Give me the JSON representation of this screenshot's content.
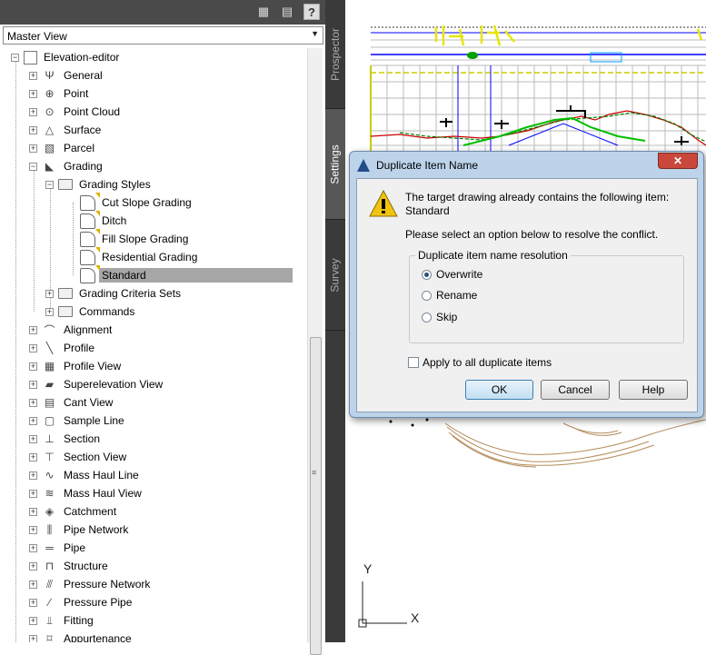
{
  "toolspace": {
    "toolbar_icons": [
      "tree-display-icon",
      "item-view-icon",
      "help-icon"
    ],
    "help_label": "?",
    "view_selector": "Master View",
    "tree": [
      {
        "label": "Elevation-editor",
        "indent": 0,
        "icon": "drawing-icon"
      },
      {
        "label": "General",
        "indent": 1,
        "icon": "general-icon"
      },
      {
        "label": "Point",
        "indent": 1,
        "icon": "point-icon"
      },
      {
        "label": "Point Cloud",
        "indent": 1,
        "icon": "point-cloud-icon"
      },
      {
        "label": "Surface",
        "indent": 1,
        "icon": "surface-icon"
      },
      {
        "label": "Parcel",
        "indent": 1,
        "icon": "parcel-icon"
      },
      {
        "label": "Grading",
        "indent": 1,
        "icon": "grading-icon"
      },
      {
        "label": "Grading Styles",
        "indent": 2,
        "icon": "folder-icon"
      },
      {
        "label": "Cut Slope Grading",
        "indent": 3,
        "icon": "style-icon"
      },
      {
        "label": "Ditch",
        "indent": 3,
        "icon": "style-icon"
      },
      {
        "label": "Fill Slope Grading",
        "indent": 3,
        "icon": "style-icon"
      },
      {
        "label": "Residential Grading",
        "indent": 3,
        "icon": "style-icon"
      },
      {
        "label": "Standard",
        "indent": 3,
        "icon": "style-icon",
        "selected": true
      },
      {
        "label": "Grading Criteria Sets",
        "indent": 2,
        "icon": "folder-icon"
      },
      {
        "label": "Commands",
        "indent": 2,
        "icon": "folder-icon"
      },
      {
        "label": "Alignment",
        "indent": 1,
        "icon": "alignment-icon"
      },
      {
        "label": "Profile",
        "indent": 1,
        "icon": "profile-icon"
      },
      {
        "label": "Profile View",
        "indent": 1,
        "icon": "profile-view-icon"
      },
      {
        "label": "Superelevation View",
        "indent": 1,
        "icon": "superelevation-view-icon"
      },
      {
        "label": "Cant View",
        "indent": 1,
        "icon": "cant-view-icon"
      },
      {
        "label": "Sample Line",
        "indent": 1,
        "icon": "sample-line-icon"
      },
      {
        "label": "Section",
        "indent": 1,
        "icon": "section-icon"
      },
      {
        "label": "Section View",
        "indent": 1,
        "icon": "section-view-icon"
      },
      {
        "label": "Mass Haul Line",
        "indent": 1,
        "icon": "mass-haul-line-icon"
      },
      {
        "label": "Mass Haul View",
        "indent": 1,
        "icon": "mass-haul-view-icon"
      },
      {
        "label": "Catchment",
        "indent": 1,
        "icon": "catchment-icon"
      },
      {
        "label": "Pipe Network",
        "indent": 1,
        "icon": "pipe-network-icon"
      },
      {
        "label": "Pipe",
        "indent": 1,
        "icon": "pipe-icon"
      },
      {
        "label": "Structure",
        "indent": 1,
        "icon": "structure-icon"
      },
      {
        "label": "Pressure Network",
        "indent": 1,
        "icon": "pressure-network-icon"
      },
      {
        "label": "Pressure Pipe",
        "indent": 1,
        "icon": "pressure-pipe-icon"
      },
      {
        "label": "Fitting",
        "indent": 1,
        "icon": "fitting-icon"
      },
      {
        "label": "Appurtenance",
        "indent": 1,
        "icon": "appurtenance-icon"
      }
    ],
    "tabs": [
      {
        "label": "Prospector",
        "active": false
      },
      {
        "label": "Settings",
        "active": true
      },
      {
        "label": "Survey",
        "active": false
      }
    ]
  },
  "drawing": {
    "ucs_x": "X",
    "ucs_y": "Y"
  },
  "dialog": {
    "title": "Duplicate Item Name",
    "close_label": "✕",
    "message_line1": "The target drawing already contains the following item:",
    "message_item": "Standard",
    "message_line2": "Please select an option below to resolve the conflict.",
    "group_label": "Duplicate item name resolution",
    "options": [
      {
        "label": "Overwrite",
        "selected": true
      },
      {
        "label": "Rename",
        "selected": false
      },
      {
        "label": "Skip",
        "selected": false
      }
    ],
    "apply_all_label": "Apply to all duplicate items",
    "apply_all_checked": false,
    "buttons": {
      "ok": "OK",
      "cancel": "Cancel",
      "help": "Help"
    }
  }
}
